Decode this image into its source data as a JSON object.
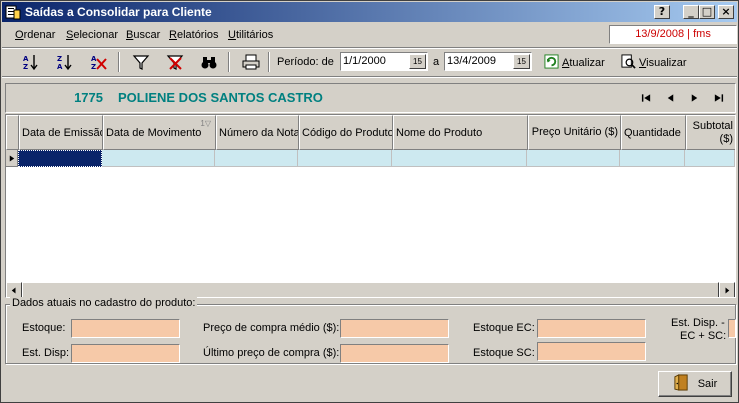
{
  "window": {
    "title": "Saídas a Consolidar para Cliente",
    "help_btn": "?",
    "min_btn": "_",
    "max_btn": "□",
    "close_btn": "×"
  },
  "menu": {
    "items": [
      "Ordenar",
      "Selecionar",
      "Buscar",
      "Relatórios",
      "Utilitários"
    ],
    "status_date": "13/9/2008 | fms"
  },
  "toolbar": {
    "periodo_label": "Período: de",
    "date_from": "1/1/2000",
    "date_sep": "a",
    "date_to": "13/4/2009",
    "cal_glyph": "15",
    "atualizar": "Atualizar",
    "visualizar": "Visualizar"
  },
  "customer": {
    "id": "1775",
    "name": "POLIENE DOS SANTOS CASTRO"
  },
  "grid": {
    "columns": [
      "Data de Emissão",
      "Data de Movimento",
      "Número da Nota",
      "Código do Produto",
      "Nome do Produto",
      "Preço Unitário ($)",
      "Quantidade",
      "Subtotal ($)"
    ]
  },
  "product_panel": {
    "legend": "Dados atuais no cadastro do produto:",
    "estoque": "Estoque:",
    "est_disp": "Est. Disp:",
    "preco_medio": "Preço de compra médio ($):",
    "ultimo_preco": "Último preço de compra ($):",
    "estoque_ec": "Estoque EC:",
    "estoque_sc": "Estoque SC:",
    "est_disp_ec_sc_1": "Est. Disp. -",
    "est_disp_ec_sc_2": "EC + SC:"
  },
  "footer": {
    "sair": "Sair"
  }
}
